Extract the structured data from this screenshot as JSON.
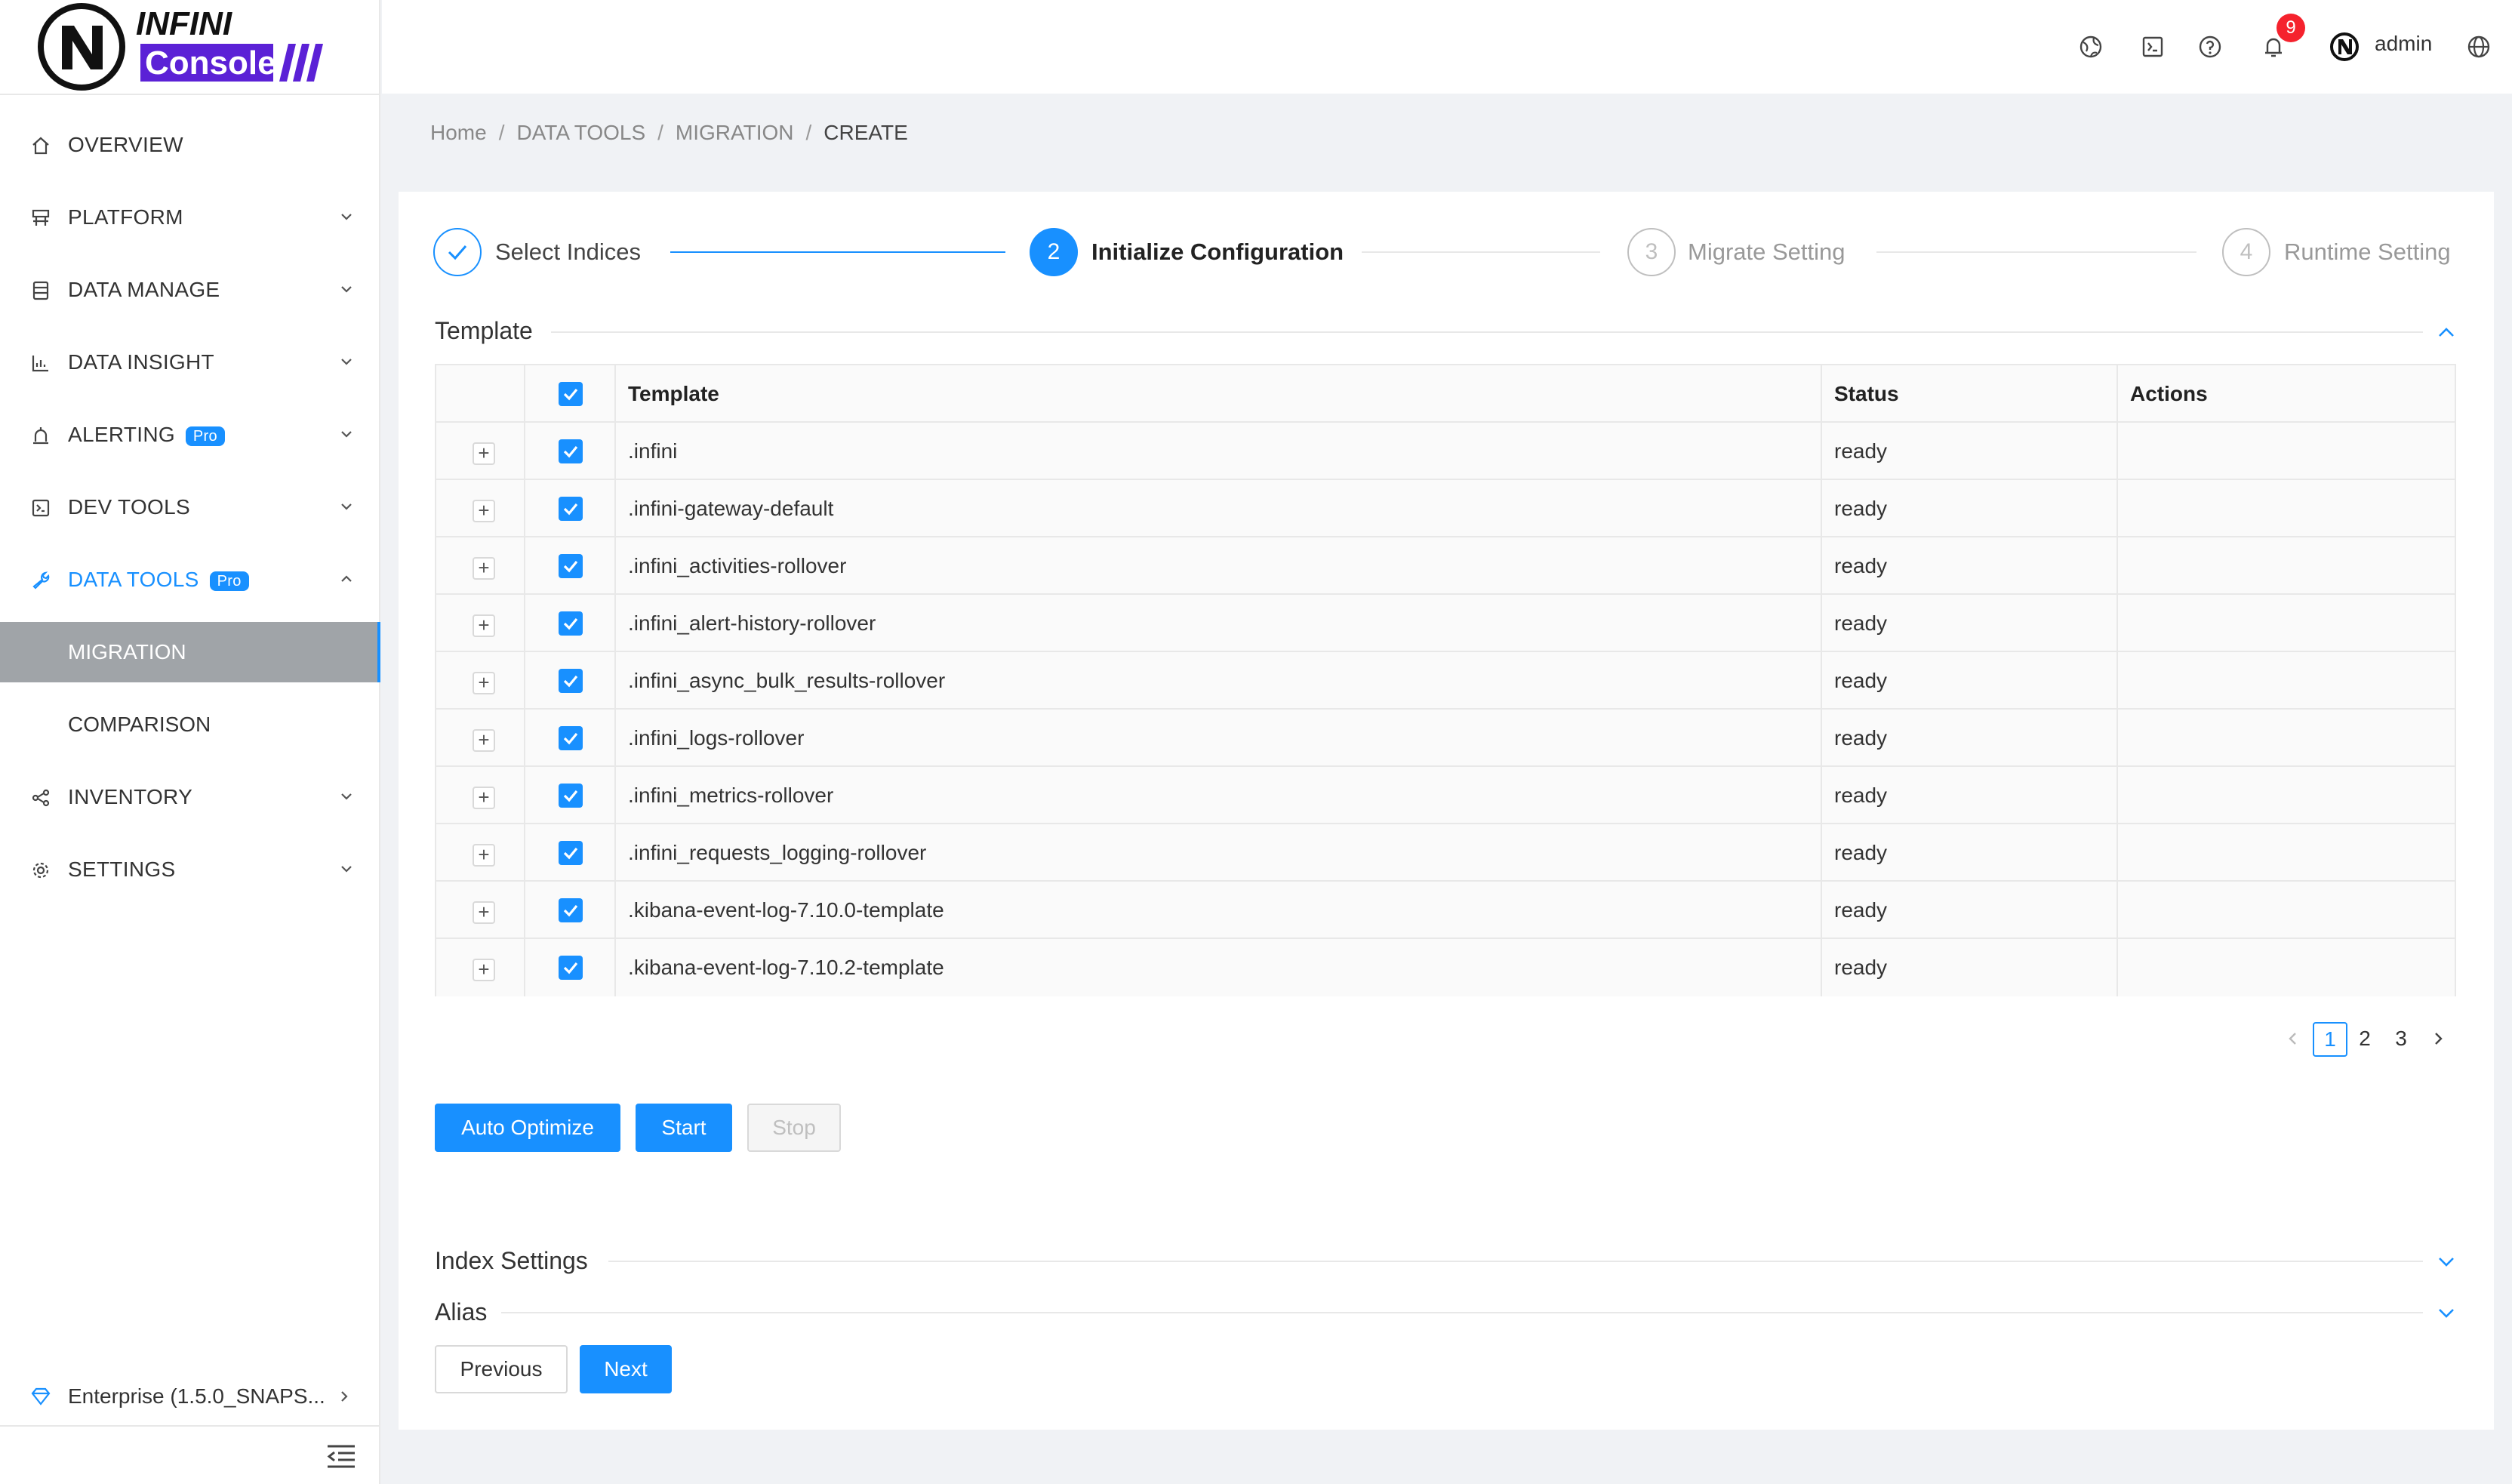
{
  "brand": {
    "line1": "INFINI",
    "line2": "Console"
  },
  "sidebar": {
    "items": [
      {
        "label": "OVERVIEW",
        "icon": "home-icon",
        "has_chevron": false
      },
      {
        "label": "PLATFORM",
        "icon": "platform-icon",
        "has_chevron": true
      },
      {
        "label": "DATA MANAGE",
        "icon": "database-icon",
        "has_chevron": true
      },
      {
        "label": "DATA INSIGHT",
        "icon": "chart-icon",
        "has_chevron": true
      },
      {
        "label": "ALERTING",
        "icon": "alarm-icon",
        "has_chevron": true,
        "badge": "Pro"
      },
      {
        "label": "DEV TOOLS",
        "icon": "terminal-icon",
        "has_chevron": true
      },
      {
        "label": "DATA TOOLS",
        "icon": "wrench-icon",
        "has_chevron": true,
        "badge": "Pro",
        "expanded": true
      },
      {
        "label": "INVENTORY",
        "icon": "share-icon",
        "has_chevron": true
      },
      {
        "label": "SETTINGS",
        "icon": "gear-icon",
        "has_chevron": true
      }
    ],
    "sub_items": [
      {
        "label": "MIGRATION",
        "selected": true
      },
      {
        "label": "COMPARISON",
        "selected": false
      }
    ],
    "footer": {
      "edition": "Enterprise (1.5.0_SNAPS..."
    }
  },
  "header": {
    "notifications_count": "9",
    "username": "admin"
  },
  "breadcrumb": [
    "Home",
    "DATA TOOLS",
    "MIGRATION",
    "CREATE"
  ],
  "steps": [
    {
      "num": "1",
      "title": "Select Indices",
      "state": "done"
    },
    {
      "num": "2",
      "title": "Initialize Configuration",
      "state": "active"
    },
    {
      "num": "3",
      "title": "Migrate Setting",
      "state": "wait"
    },
    {
      "num": "4",
      "title": "Runtime Setting",
      "state": "wait"
    }
  ],
  "template_section": {
    "title": "Template",
    "columns": [
      "Template",
      "Status",
      "Actions"
    ],
    "rows": [
      {
        "name": ".infini",
        "status": "ready"
      },
      {
        "name": ".infini-gateway-default",
        "status": "ready"
      },
      {
        "name": ".infini_activities-rollover",
        "status": "ready"
      },
      {
        "name": ".infini_alert-history-rollover",
        "status": "ready"
      },
      {
        "name": ".infini_async_bulk_results-rollover",
        "status": "ready"
      },
      {
        "name": ".infini_logs-rollover",
        "status": "ready"
      },
      {
        "name": ".infini_metrics-rollover",
        "status": "ready"
      },
      {
        "name": ".infini_requests_logging-rollover",
        "status": "ready"
      },
      {
        "name": ".kibana-event-log-7.10.0-template",
        "status": "ready"
      },
      {
        "name": ".kibana-event-log-7.10.2-template",
        "status": "ready"
      }
    ],
    "pagination": {
      "pages": [
        "1",
        "2",
        "3"
      ],
      "current": "1"
    },
    "buttons": {
      "auto_optimize": "Auto Optimize",
      "start": "Start",
      "stop": "Stop"
    }
  },
  "index_settings": {
    "title": "Index Settings"
  },
  "alias": {
    "title": "Alias"
  },
  "footer_buttons": {
    "previous": "Previous",
    "next": "Next"
  },
  "colors": {
    "primary": "#1890ff",
    "badge": "#f5222d",
    "selected_bg": "#a0a4a8"
  }
}
